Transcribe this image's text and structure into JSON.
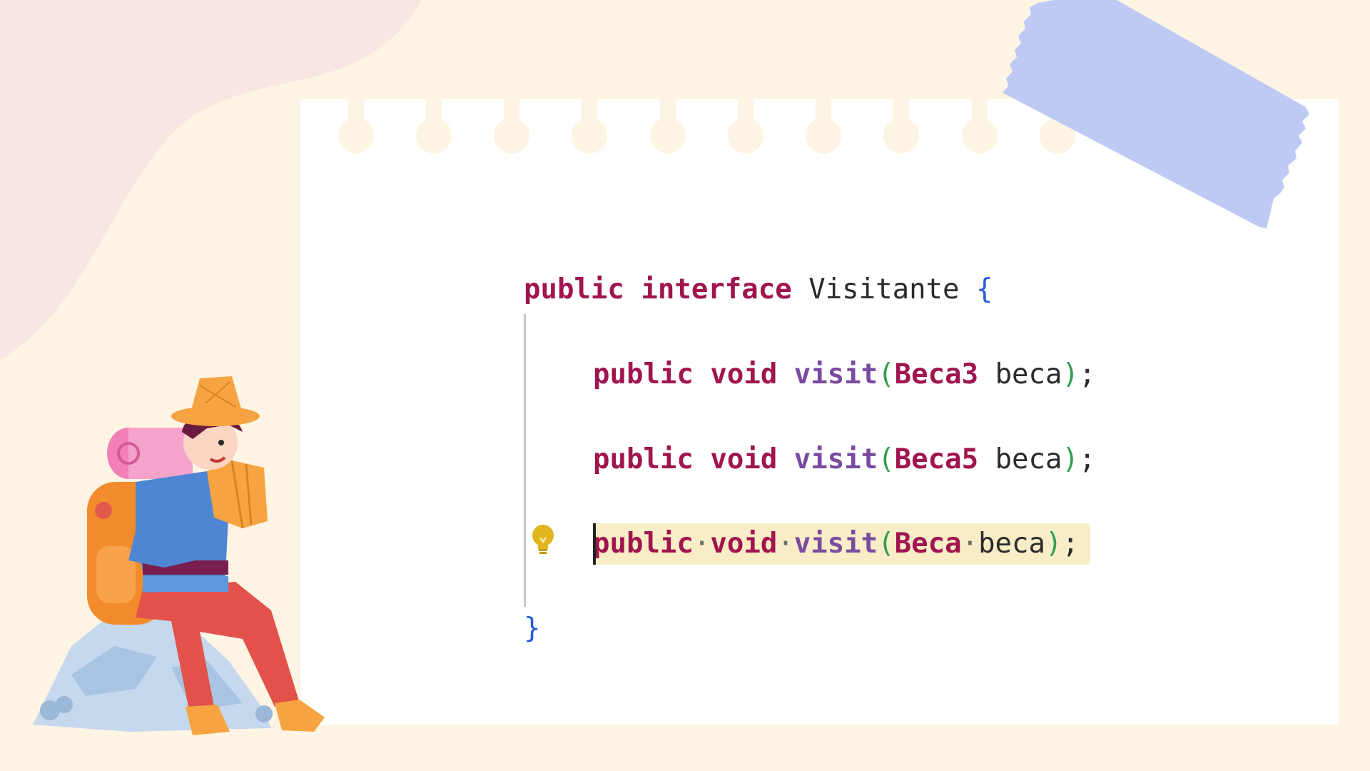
{
  "code": {
    "line1": {
      "kw1": "public",
      "kw2": "interface",
      "name": "Visitante",
      "brace": "{"
    },
    "line2": {
      "kw1": "public",
      "kw2": "void",
      "fn": "visit",
      "lp": "(",
      "type": "Beca3",
      "param": "beca",
      "rp": ")",
      "semi": ";"
    },
    "line3": {
      "kw1": "public",
      "kw2": "void",
      "fn": "visit",
      "lp": "(",
      "type": "Beca5",
      "param": "beca",
      "rp": ")",
      "semi": ";"
    },
    "line4": {
      "kw1": "public",
      "dot1": "·",
      "kw2": "void",
      "dot2": "·",
      "fn": "visit",
      "lp": "(",
      "type": "Beca",
      "dot3": "·",
      "param": "beca",
      "rp": ")",
      "semi": ";"
    },
    "close": "}"
  },
  "icons": [
    "lightbulb-icon",
    "traveler-illustration",
    "paper-tape",
    "notebook-paper"
  ],
  "colors": {
    "background": "#fdf4e3",
    "blob": "#f8e6e2",
    "paper": "#ffffff",
    "tape": "#bfcaf4",
    "keyword": "#a0144f",
    "method": "#7a4aa0",
    "brace": "#2a5cd9",
    "paren": "#2e9e4f",
    "highlight": "#f8edc6",
    "bulb": "#e0b51d"
  }
}
